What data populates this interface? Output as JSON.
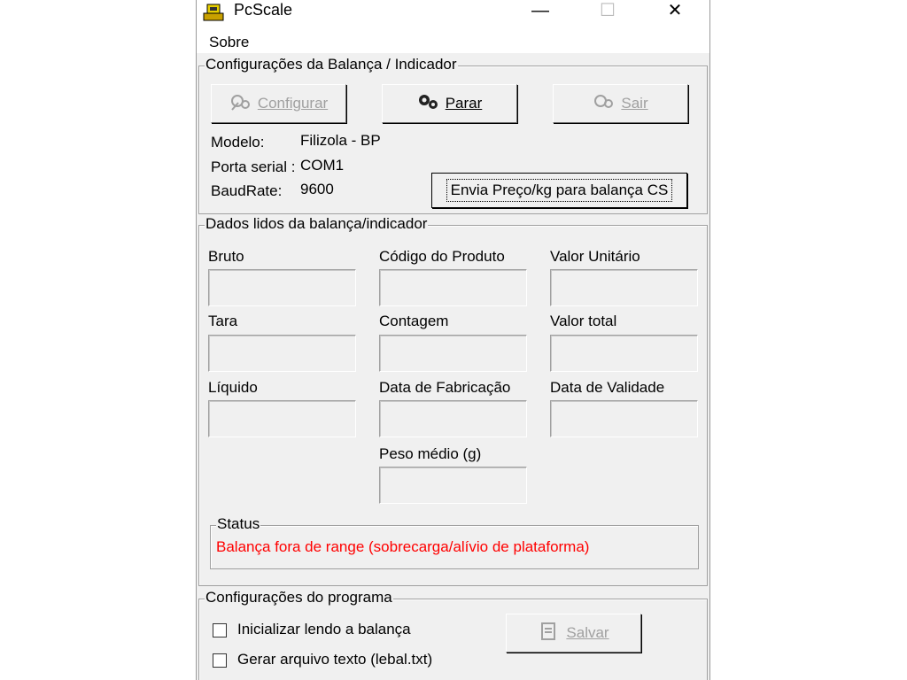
{
  "window": {
    "title": "PcScale"
  },
  "caption_buttons": {
    "minimize": "—",
    "maximize": "☐",
    "close": "✕"
  },
  "menu": {
    "about": "Sobre"
  },
  "scale_config": {
    "legend": "Configurações da Balança / Indicador",
    "configure_label": "Configurar",
    "stop_label": "Parar",
    "exit_label": "Sair",
    "model_label": "Modelo:",
    "model_value": "Filizola - BP",
    "port_label": "Porta serial :",
    "port_value": "COM1",
    "baud_label": "BaudRate:",
    "baud_value": "9600",
    "send_price_label": "Envia Preço/kg para balança CS"
  },
  "read_data": {
    "legend": "Dados lidos da balança/indicador",
    "fields": {
      "gross": "Bruto",
      "product_code": "Código do Produto",
      "unit_value": "Valor Unitário",
      "tare": "Tara",
      "count": "Contagem",
      "total_value": "Valor total",
      "net": "Líquido",
      "manufacture_date": "Data de Fabricação",
      "expiry_date": "Data de Validade",
      "average_weight": "Peso médio (g)"
    },
    "status": {
      "legend": "Status",
      "message": "Balança fora de range (sobrecarga/alívio de plataforma)",
      "message_color": "#ff0000"
    }
  },
  "program_config": {
    "legend": "Configurações do programa",
    "start_reading": {
      "label": "Inicializar lendo a balança",
      "checked": false
    },
    "generate_text_file": {
      "label": "Gerar arquivo texto (lebal.txt)",
      "checked": false
    },
    "save_label": "Salvar"
  },
  "icons": {
    "app": "scale-app-icon",
    "configure": "gears-icon",
    "stop": "gears-stop-icon",
    "exit": "gears-exit-icon",
    "save": "save-file-icon"
  }
}
